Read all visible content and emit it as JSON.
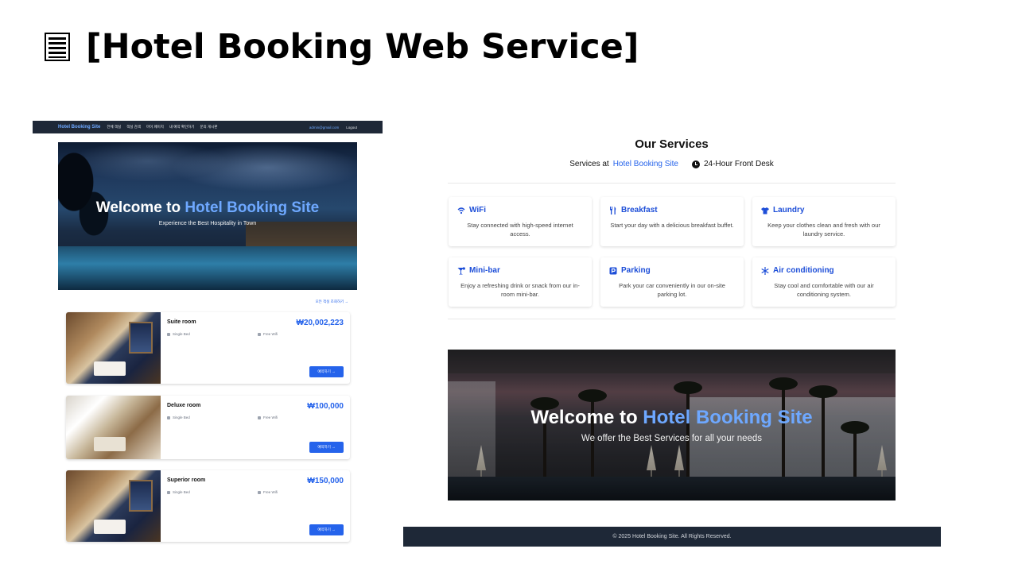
{
  "slide": {
    "title": "[Hotel Booking Web Service]"
  },
  "left": {
    "nav": {
      "brand": "Hotel Booking Site",
      "items": [
        "전체 객실",
        "객실 검색",
        "마이 페이지",
        "내 예약 확인하기",
        "문의 게시판"
      ],
      "email": "admin@gmail.com",
      "logout": "Logout"
    },
    "hero": {
      "title_prefix": "Welcome to ",
      "title_accent": "Hotel Booking Site",
      "subtitle": "Experience the Best Hospitality in Town"
    },
    "all_rooms_link": "모든 객실 조회하기 →",
    "rooms": [
      {
        "name": "Suite room",
        "price": "₩20,002,223",
        "bed": "Single Bed",
        "wifi": "Free Wifi",
        "button": "예약하기 →"
      },
      {
        "name": "Deluxe room",
        "price": "₩100,000",
        "bed": "Single Bed",
        "wifi": "Free Wifi",
        "button": "예약하기 →"
      },
      {
        "name": "Superior room",
        "price": "₩150,000",
        "bed": "Single Bed",
        "wifi": "Free Wifi",
        "button": "예약하기 →"
      }
    ]
  },
  "right": {
    "services": {
      "title": "Our Services",
      "sub_prefix": "Services at",
      "sub_accent": "Hotel Booking Site",
      "front_desk": "24-Hour Front Desk",
      "items": [
        {
          "name": "WiFi",
          "icon": "wifi-icon",
          "desc": "Stay connected with high-speed internet access."
        },
        {
          "name": "Breakfast",
          "icon": "utensils-icon",
          "desc": "Start your day with a delicious breakfast buffet."
        },
        {
          "name": "Laundry",
          "icon": "shirt-icon",
          "desc": "Keep your clothes clean and fresh with our laundry service."
        },
        {
          "name": "Mini-bar",
          "icon": "cocktail-icon",
          "desc": "Enjoy a refreshing drink or snack from our in-room mini-bar."
        },
        {
          "name": "Parking",
          "icon": "parking-icon",
          "desc": "Park your car conveniently in our on-site parking lot."
        },
        {
          "name": "Air conditioning",
          "icon": "snowflake-icon",
          "desc": "Stay cool and comfortable with our air conditioning system."
        }
      ]
    },
    "banner": {
      "title_prefix": "Welcome to ",
      "title_accent": "Hotel Booking Site",
      "subtitle": "We offer the Best Services for all your needs"
    },
    "footer": "© 2025 Hotel Booking Site. All Rights Reserved."
  },
  "colors": {
    "accent": "#2563eb",
    "accent_light": "#6ea8ff",
    "nav_bg": "#1e2837"
  }
}
